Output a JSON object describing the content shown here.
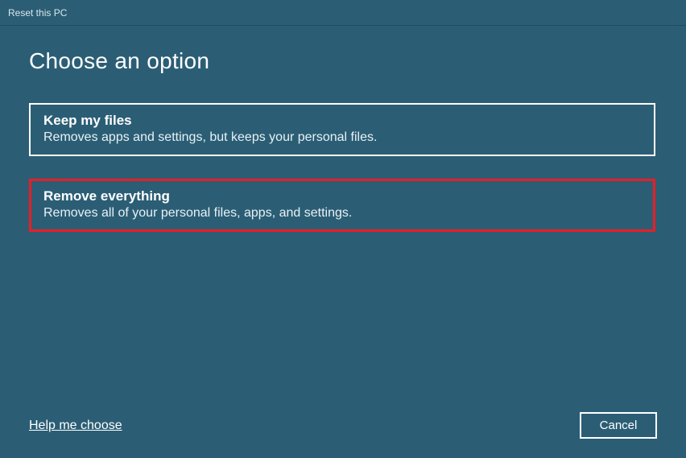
{
  "window": {
    "title": "Reset this PC"
  },
  "heading": "Choose an option",
  "options": [
    {
      "title": "Keep my files",
      "description": "Removes apps and settings, but keeps your personal files."
    },
    {
      "title": "Remove everything",
      "description": "Removes all of your personal files, apps, and settings."
    }
  ],
  "footer": {
    "help_link": "Help me choose",
    "cancel_label": "Cancel"
  },
  "colors": {
    "background": "#2b5e75",
    "highlight_border": "#ed1c24",
    "text": "#ffffff"
  }
}
